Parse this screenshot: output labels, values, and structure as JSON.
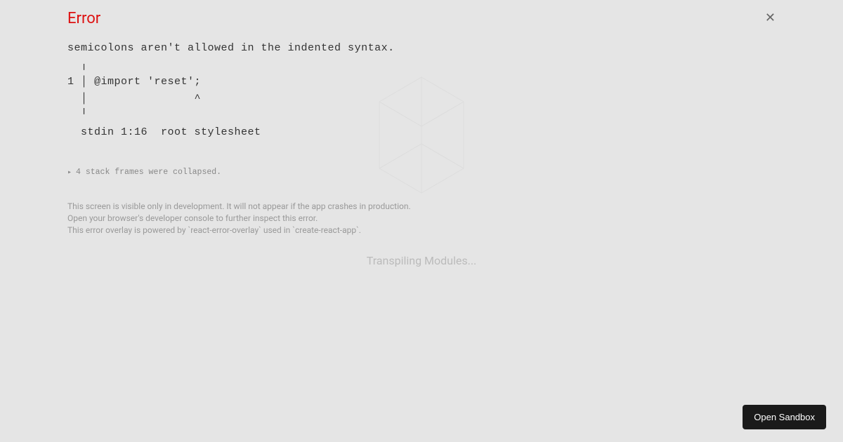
{
  "header": {
    "title": "Error"
  },
  "error": {
    "body": "semicolons aren't allowed in the indented syntax.\n  ╷\n1 │ @import 'reset';\n  │                ^\n  ╵\n  stdin 1:16  root stylesheet",
    "collapsed": "4 stack frames were collapsed."
  },
  "footer": {
    "line1": "This screen is visible only in development. It will not appear if the app crashes in production.",
    "line2": "Open your browser's developer console to further inspect this error.",
    "line3": "This error overlay is powered by `react-error-overlay` used in `create-react-app`."
  },
  "background": {
    "status": "Transpiling Modules..."
  },
  "actions": {
    "open_sandbox": "Open Sandbox"
  }
}
